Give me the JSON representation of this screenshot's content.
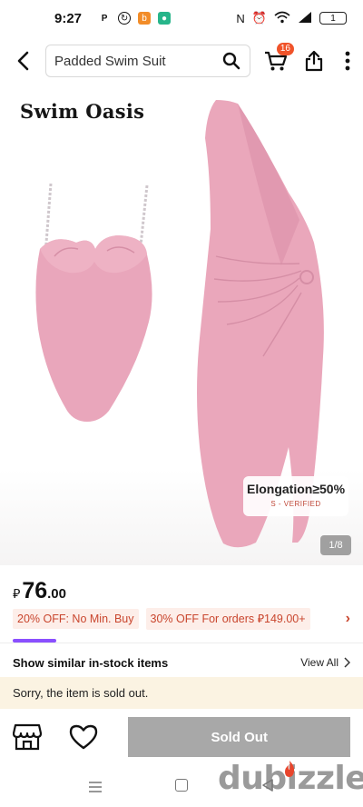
{
  "status_bar": {
    "time": "9:27",
    "app_icons": [
      "pinterest-icon",
      "sync-icon",
      "orange-app-icon",
      "green-app-icon"
    ],
    "right_icons": [
      "nfc-icon",
      "alarm-icon",
      "wifi-icon",
      "signal-icon"
    ],
    "battery": "1"
  },
  "top_bar": {
    "search_value": "Padded Swim Suit",
    "cart_count": "16"
  },
  "product_image": {
    "brand": "Swim Oasis",
    "badge_main": "Elongation≥50%",
    "badge_sub": "S - VERIFIED",
    "counter": "1/8",
    "swimsuit_color": "#e9a6bb",
    "dress_color": "#eaa7bb"
  },
  "price": {
    "currency": "⃁",
    "integer": "76",
    "decimal": ".00"
  },
  "promotions": [
    "20% OFF: No Min. Buy",
    "30% OFF For orders ⃁149.00+"
  ],
  "similar": {
    "title": "Show similar in-stock items",
    "view_all": "View All"
  },
  "sold_out_message": "Sorry, the item is sold out.",
  "bottom_bar": {
    "button_label": "Sold Out"
  },
  "watermark": "dubizzle",
  "colors": {
    "accent_red": "#c9462e",
    "promo_bg": "#fdeee9",
    "banner_bg": "#fbf3e2",
    "disabled_button": "#a8a8a8",
    "badge_red": "#f0532a",
    "strip_purple": "#8a4fff"
  }
}
